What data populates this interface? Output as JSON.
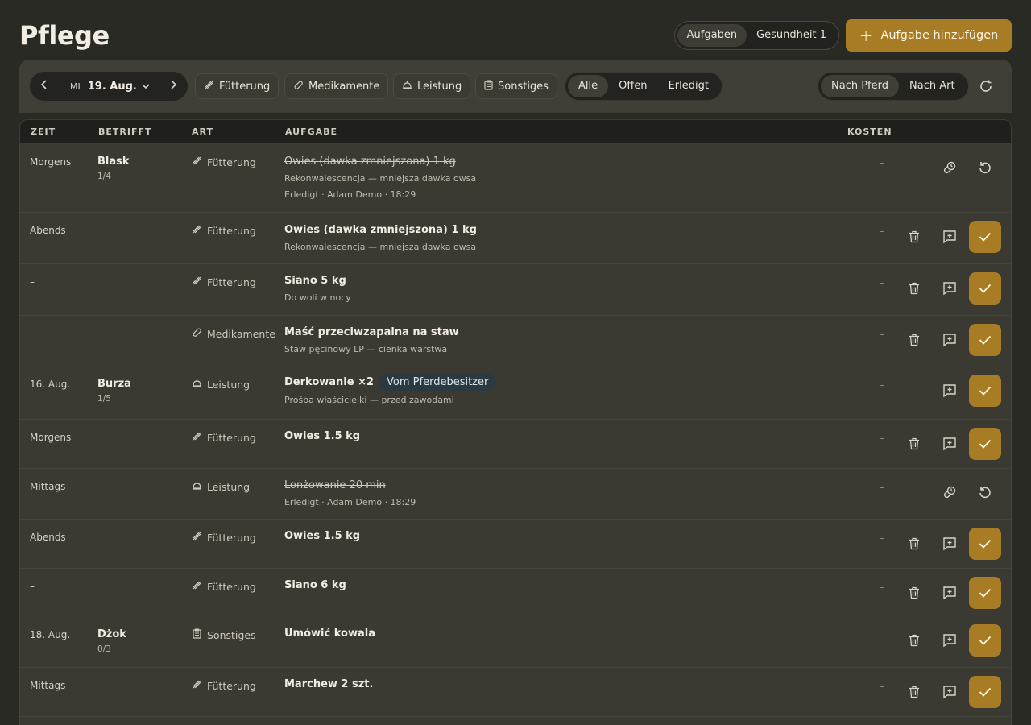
{
  "header": {
    "title": "Pflege",
    "tabs": [
      {
        "label": "Aufgaben",
        "active": true
      },
      {
        "label": "Gesundheit 1",
        "active": false
      }
    ],
    "add_button": "Aufgabe hinzufügen"
  },
  "toolbar": {
    "day_of_week": "MI",
    "date": "19. Aug.",
    "categories": [
      "Fütterung",
      "Medikamente",
      "Leistung",
      "Sonstiges"
    ],
    "status_filter": [
      "Alle",
      "Offen",
      "Erledigt"
    ],
    "status_active": "Alle",
    "group_by": [
      "Nach Pferd",
      "Nach Art"
    ],
    "group_active": "Nach Pferd"
  },
  "table": {
    "headers": [
      "ZEIT",
      "BETRIFFT",
      "ART",
      "AUFGABE",
      "KOSTEN"
    ],
    "rows": [
      {
        "time": "Morgens",
        "horse": "Blask",
        "progress": "1/4",
        "type": "Fütterung",
        "type_icon": "feed-icon",
        "task": "Owies (dawka zmniejszona) 1 kg",
        "desc": "Rekonwalescencja — mniejsza dawka owsa",
        "meta": "Erledigt · Adam Demo · 18:29",
        "done": true,
        "cost": "–"
      },
      {
        "time": "Abends",
        "horse": "",
        "progress": "",
        "type": "Fütterung",
        "type_icon": "feed-icon",
        "task": "Owies (dawka zmniejszona) 1 kg",
        "desc": "Rekonwalescencja — mniejsza dawka owsa",
        "meta": "",
        "done": false,
        "cost": "–"
      },
      {
        "time": "–",
        "horse": "",
        "progress": "",
        "type": "Fütterung",
        "type_icon": "feed-icon",
        "task": "Siano 5 kg",
        "desc": "Do woli w nocy",
        "meta": "",
        "done": false,
        "cost": "–"
      },
      {
        "time": "–",
        "horse": "",
        "progress": "",
        "type": "Medikamente",
        "type_icon": "pill-icon",
        "task": "Maść przeciwzapalna na staw",
        "desc": "Staw pęcinowy LP — cienka warstwa",
        "meta": "",
        "done": false,
        "cost": "–"
      },
      {
        "time": "16. Aug.",
        "horse": "Burza",
        "progress": "1/5",
        "type": "Leistung",
        "type_icon": "bell-icon",
        "task": "Derkowanie ×2",
        "badge": "Vom Pferdebesitzer",
        "desc": "Prośba właścicielki — przed zawodami",
        "meta": "",
        "done": false,
        "cost": "–"
      },
      {
        "time": "Morgens",
        "horse": "",
        "progress": "",
        "type": "Fütterung",
        "type_icon": "feed-icon",
        "task": "Owies 1.5 kg",
        "desc": "",
        "meta": "",
        "done": false,
        "cost": "–"
      },
      {
        "time": "Mittags",
        "horse": "",
        "progress": "",
        "type": "Leistung",
        "type_icon": "bell-icon",
        "task": "Lonżowanie 20 min",
        "desc": "",
        "meta": "Erledigt · Adam Demo · 18:29",
        "done": true,
        "cost": "–"
      },
      {
        "time": "Abends",
        "horse": "",
        "progress": "",
        "type": "Fütterung",
        "type_icon": "feed-icon",
        "task": "Owies 1.5 kg",
        "desc": "",
        "meta": "",
        "done": false,
        "cost": "–"
      },
      {
        "time": "–",
        "horse": "",
        "progress": "",
        "type": "Fütterung",
        "type_icon": "feed-icon",
        "task": "Siano 6 kg",
        "desc": "",
        "meta": "",
        "done": false,
        "cost": "–"
      },
      {
        "time": "18. Aug.",
        "horse": "Dżok",
        "progress": "0/3",
        "type": "Sonstiges",
        "type_icon": "clipboard-icon",
        "task": "Umówić kowala",
        "desc": "",
        "meta": "",
        "done": false,
        "cost": "–"
      },
      {
        "time": "Mittags",
        "horse": "",
        "progress": "",
        "type": "Fütterung",
        "type_icon": "feed-icon",
        "task": "Marchew 2 szt.",
        "desc": "",
        "meta": "",
        "done": false,
        "cost": "–"
      }
    ]
  },
  "colors": {
    "accent": "#a87c24",
    "background": "#2a2a25",
    "surface": "#3a3932",
    "badge": "#2b3a40"
  }
}
